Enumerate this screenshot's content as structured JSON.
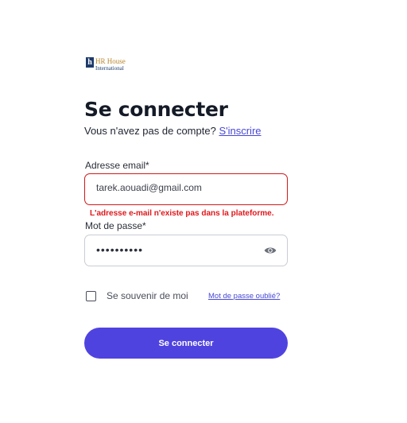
{
  "logo": {
    "mark": "h",
    "line1": "HR House",
    "line2": "International"
  },
  "title": "Se connecter",
  "signup": {
    "prompt": "Vous n'avez pas de compte?",
    "link": "S'inscrire"
  },
  "email": {
    "label": "Adresse email*",
    "value": "tarek.aouadi@gmail.com",
    "error": "L'adresse e-mail n'existe pas dans la plateforme."
  },
  "password": {
    "label": "Mot de passe*",
    "value": "••••••••••",
    "icon": "eye-icon"
  },
  "remember": {
    "label": "Se souvenir de moi",
    "checked": false
  },
  "forgot": "Mot de passe oublié?",
  "submit": "Se connecter",
  "colors": {
    "accent": "#4f43e0",
    "link": "#4747d6",
    "error": "#e0171b"
  }
}
